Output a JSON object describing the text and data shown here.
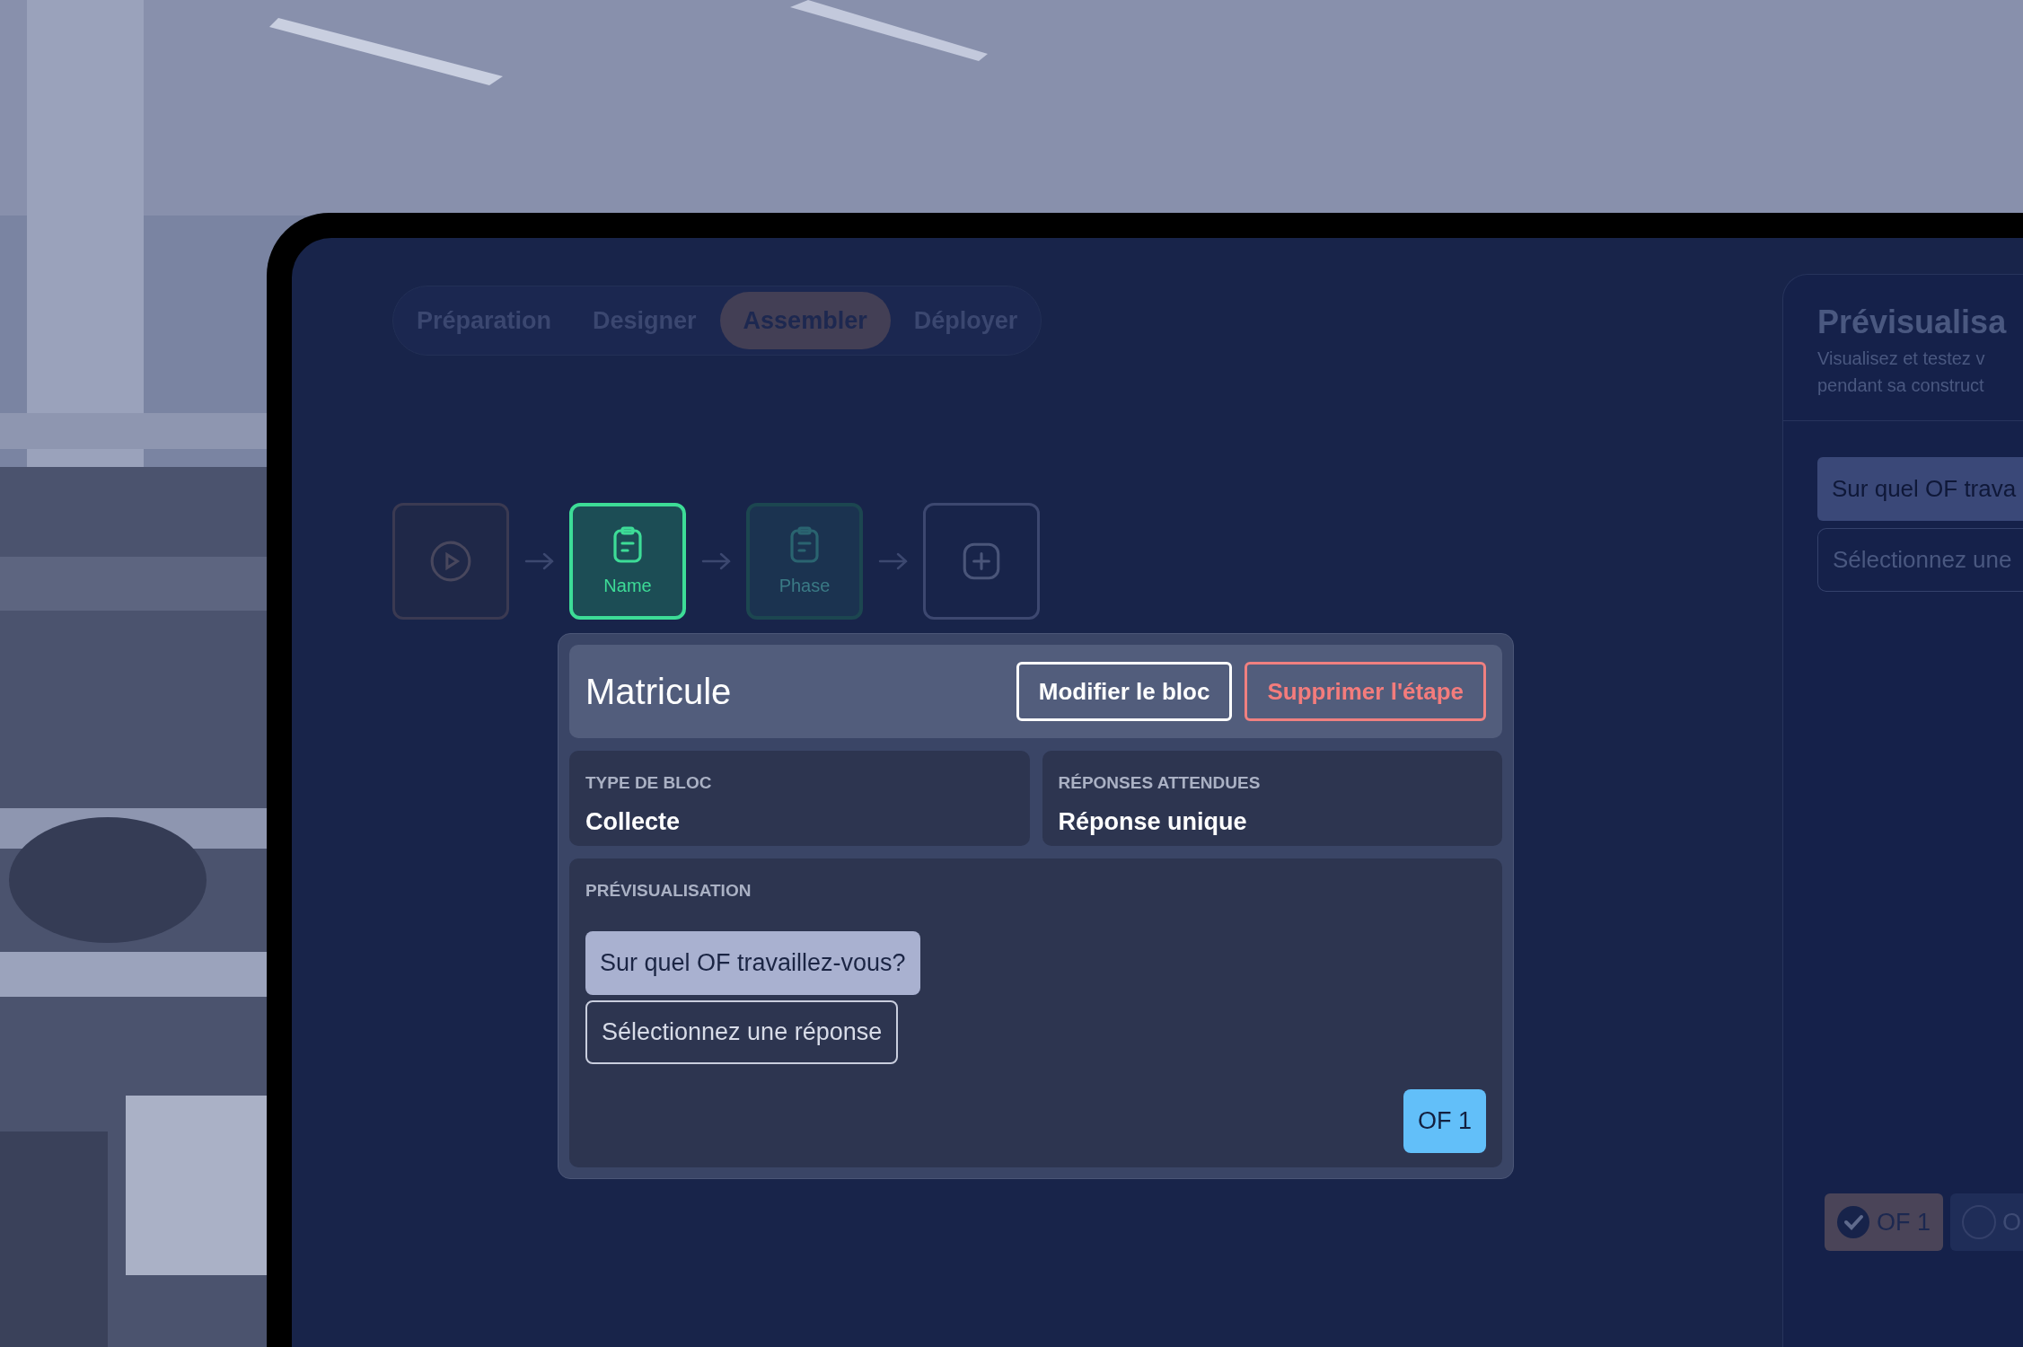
{
  "tabs": [
    {
      "label": "Préparation",
      "selected": false
    },
    {
      "label": "Designer",
      "selected": false
    },
    {
      "label": "Assembler",
      "selected": true
    },
    {
      "label": "Déployer",
      "selected": false
    }
  ],
  "steps": [
    {
      "kind": "start"
    },
    {
      "kind": "block",
      "label": "Name",
      "selected": true
    },
    {
      "kind": "block",
      "label": "Phase",
      "selected": false
    },
    {
      "kind": "add"
    }
  ],
  "block_card": {
    "title": "Matricule",
    "buttons": [
      {
        "label": "Modifier le bloc",
        "kind": "edit"
      },
      {
        "label": "Supprimer l'étape",
        "kind": "delete"
      }
    ],
    "fields": [
      {
        "label": "TYPE DE BLOC",
        "value": "Collecte"
      },
      {
        "label": "RÉPONSES ATTENDUES",
        "value": "Réponse unique"
      }
    ],
    "preview": {
      "label": "PRÉVISUALISATION",
      "question": "Sur quel OF travaillez-vous?",
      "select_placeholder": "Sélectionnez une réponse",
      "answer_chip": "OF 1"
    }
  },
  "preview_panel": {
    "title": "Prévisualisa",
    "subtitle_lines": [
      "Visualisez et testez v",
      "pendant sa construct"
    ],
    "question": "Sur quel OF trava",
    "select_placeholder": "Sélectionnez une",
    "options": [
      {
        "label": "OF 1",
        "checked": true
      },
      {
        "label": "O",
        "checked": false
      }
    ]
  }
}
